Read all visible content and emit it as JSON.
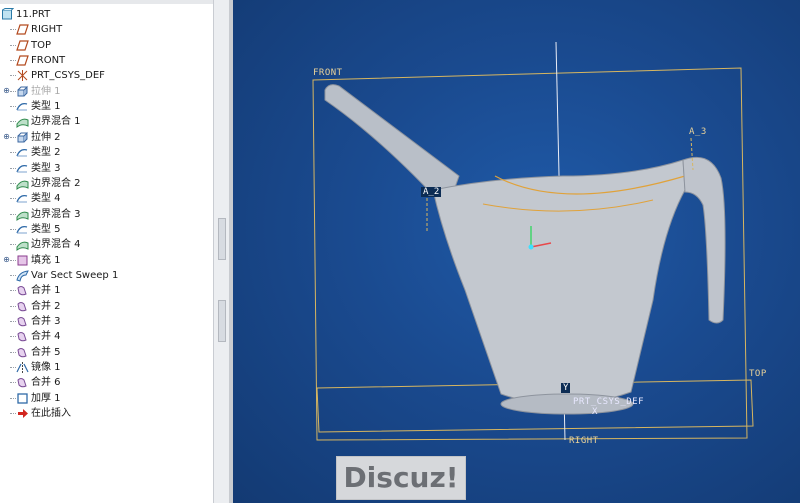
{
  "model_tree": {
    "items": [
      {
        "label": "11.PRT",
        "icon": "part-icon"
      },
      {
        "label": "RIGHT",
        "icon": "datum-plane-icon"
      },
      {
        "label": "TOP",
        "icon": "datum-plane-icon"
      },
      {
        "label": "FRONT",
        "icon": "datum-plane-icon"
      },
      {
        "label": "PRT_CSYS_DEF",
        "icon": "csys-icon"
      },
      {
        "label": "拉伸 1",
        "icon": "extrude-icon",
        "suppressed": true,
        "expandable": true
      },
      {
        "label": "类型 1",
        "icon": "sketch-icon"
      },
      {
        "label": "边界混合 1",
        "icon": "boundary-blend-icon"
      },
      {
        "label": "拉伸 2",
        "icon": "extrude-icon",
        "expandable": true
      },
      {
        "label": "类型 2",
        "icon": "sketch-icon"
      },
      {
        "label": "类型 3",
        "icon": "sketch-icon"
      },
      {
        "label": "边界混合 2",
        "icon": "boundary-blend-icon"
      },
      {
        "label": "类型 4",
        "icon": "sketch-icon"
      },
      {
        "label": "边界混合 3",
        "icon": "boundary-blend-icon"
      },
      {
        "label": "类型 5",
        "icon": "sketch-icon"
      },
      {
        "label": "边界混合 4",
        "icon": "boundary-blend-icon"
      },
      {
        "label": "填充 1",
        "icon": "fill-icon",
        "expandable": true
      },
      {
        "label": "Var Sect Sweep 1",
        "icon": "sweep-icon"
      },
      {
        "label": "合并 1",
        "icon": "merge-icon"
      },
      {
        "label": "合并 2",
        "icon": "merge-icon"
      },
      {
        "label": "合并 3",
        "icon": "merge-icon"
      },
      {
        "label": "合并 4",
        "icon": "merge-icon"
      },
      {
        "label": "合并 5",
        "icon": "merge-icon"
      },
      {
        "label": "镜像 1",
        "icon": "mirror-icon"
      },
      {
        "label": "合并 6",
        "icon": "merge-icon"
      },
      {
        "label": "加厚 1",
        "icon": "thicken-icon"
      },
      {
        "label": "在此插入",
        "icon": "insert-here-arrow-icon"
      }
    ]
  },
  "viewport": {
    "labels": {
      "front": "FRONT",
      "top": "TOP",
      "right": "RIGHT",
      "csys": "PRT_CSYS_DEF",
      "axis_a2": "A_2",
      "axis_a3": "A_3",
      "axis_y": "Y",
      "axis_x": "X"
    },
    "colors": {
      "background": "#1a4a8f",
      "datum": "#d7b660",
      "model": "#c7ccd3"
    }
  },
  "watermark": {
    "text": "Discuz!"
  }
}
